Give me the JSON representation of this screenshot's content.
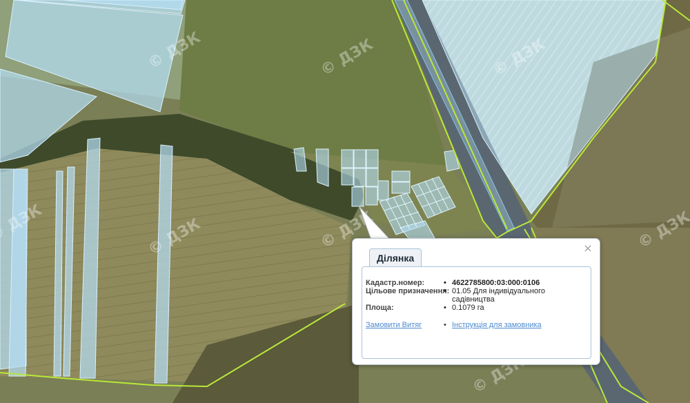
{
  "map": {
    "watermark": "© ДЗК",
    "colors": {
      "parcel_fill": "#b3dcf2",
      "parcel_stroke": "#7fc4ea",
      "boundary_line": "#b9e83a",
      "highway": "#5a6770"
    }
  },
  "popup": {
    "tab_label": "Ділянка",
    "close_label": "×",
    "cadastral_label": "Кадастр.номер:",
    "cadastral_value": "4622785800:03:000:0106",
    "purpose_label": "Цільове призначення:",
    "purpose_value_line1": "01.05 Для індивідуального",
    "purpose_value_line2": "садівництва",
    "area_label": "Площа:",
    "area_value": "0.1079 га",
    "order_link": "Замовити Витяг",
    "instruction_link": "Інструкція для замовника"
  }
}
